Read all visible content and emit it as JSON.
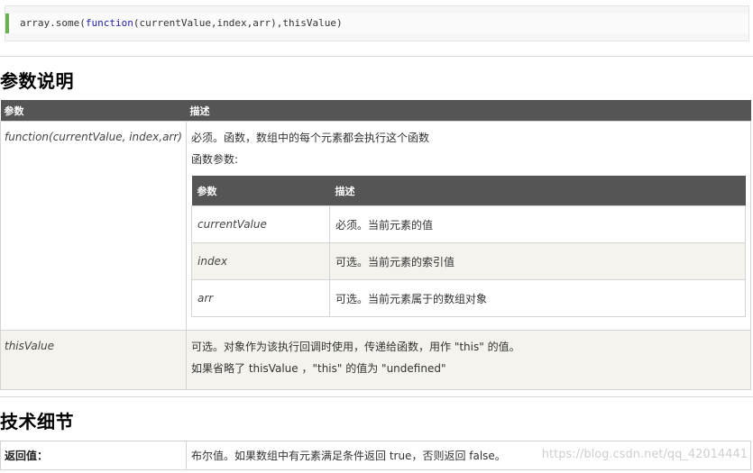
{
  "code": {
    "prefix": "array.some(",
    "keyword": "function",
    "suffix": "(currentValue,index,arr),thisValue)"
  },
  "section1": {
    "heading": "参数说明",
    "col_param": "参数",
    "col_desc": "描述",
    "row1": {
      "param": "function(currentValue, index,arr)",
      "desc1": "必须。函数，数组中的每个元素都会执行这个函数",
      "desc2": "函数参数:",
      "inner": {
        "col_param": "参数",
        "col_desc": "描述",
        "rows": [
          {
            "param": "currentValue",
            "desc": "必须。当前元素的值"
          },
          {
            "param": "index",
            "desc": "可选。当前元素的索引值"
          },
          {
            "param": "arr",
            "desc": "可选。当前元素属于的数组对象"
          }
        ]
      }
    },
    "row2": {
      "param": "thisValue",
      "desc1": "可选。对象作为该执行回调时使用，传递给函数，用作 \"this\" 的值。",
      "desc2": "如果省略了 thisValue ，\"this\" 的值为 \"undefined\""
    }
  },
  "section2": {
    "heading": "技术细节",
    "label": "返回值：",
    "value": "布尔值。如果数组中有元素满足条件返回 true，否则返回 false。"
  },
  "watermark": "https://blog.csdn.net/qq_42014441"
}
